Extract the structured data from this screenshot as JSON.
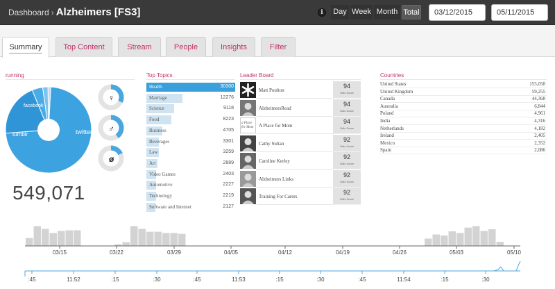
{
  "header": {
    "breadcrumb_home": "Dashboard",
    "breadcrumb_sep": "›",
    "breadcrumb_current": "Alzheimers [FS3]",
    "info_glyph": "i",
    "periods": [
      "Day",
      "Week",
      "Month",
      "Total"
    ],
    "active_period": "Total",
    "start_date": "03/12/2015",
    "end_date": "05/11/2015"
  },
  "tabs": [
    "Summary",
    "Top Content",
    "Stream",
    "People",
    "Insights",
    "Filter"
  ],
  "active_tab": "Summary",
  "source": {
    "title": "running",
    "total": "549,071",
    "donut_labels": [
      "twitter",
      "tumblr",
      "facebook"
    ],
    "donut_values": [
      73,
      20,
      4,
      2,
      1
    ],
    "colors": [
      "#3da3e0",
      "#2f95d6",
      "#4aace6",
      "#7cc3ee",
      "#b5dcf5"
    ],
    "gender": [
      {
        "icon": "female-icon",
        "glyph": "♀",
        "share": 0.32
      },
      {
        "icon": "male-icon",
        "glyph": "♂",
        "share": 0.4
      },
      {
        "icon": "unknown-gender-icon",
        "glyph": "ø",
        "share": 0.18
      }
    ]
  },
  "top_topics": {
    "title": "Top Topics",
    "items": [
      {
        "label": "Health",
        "value": "30300",
        "n": 30300
      },
      {
        "label": "Marriage",
        "value": "12276",
        "n": 12276
      },
      {
        "label": "Science",
        "value": "9118",
        "n": 9118
      },
      {
        "label": "Food",
        "value": "8223",
        "n": 8223
      },
      {
        "label": "Business",
        "value": "4705",
        "n": 4705
      },
      {
        "label": "Beverages",
        "value": "3301",
        "n": 3301
      },
      {
        "label": "Law",
        "value": "3259",
        "n": 3259
      },
      {
        "label": "Art",
        "value": "2889",
        "n": 2889
      },
      {
        "label": "Video Games",
        "value": "2403",
        "n": 2403
      },
      {
        "label": "Automotive",
        "value": "2227",
        "n": 2227
      },
      {
        "label": "Technology",
        "value": "2219",
        "n": 2219
      },
      {
        "label": "Software and Internet",
        "value": "2127",
        "n": 2127
      }
    ]
  },
  "leader_board": {
    "title": "Leader Board",
    "score_label": "Odio Score",
    "items": [
      {
        "name": "Matt Poulton",
        "score": "94"
      },
      {
        "name": "AlzheimersRead",
        "score": "94"
      },
      {
        "name": "A Place for Mom",
        "score": "94"
      },
      {
        "name": "Cathy Sultan",
        "score": "92"
      },
      {
        "name": "Caroline Kerley",
        "score": "92"
      },
      {
        "name": "Alzheimers Links",
        "score": "92"
      },
      {
        "name": "Training For Carers",
        "score": "92"
      }
    ],
    "logo_text": "a Place for Mom"
  },
  "countries": {
    "title": "Countries",
    "items": [
      {
        "name": "United States",
        "value": "155,058"
      },
      {
        "name": "United Kingdom",
        "value": "59,255"
      },
      {
        "name": "Canada",
        "value": "44,368"
      },
      {
        "name": "Australia",
        "value": "6,844"
      },
      {
        "name": "Poland",
        "value": "4,961"
      },
      {
        "name": "India",
        "value": "4,316"
      },
      {
        "name": "Netherlands",
        "value": "4,182"
      },
      {
        "name": "Ireland",
        "value": "2,405"
      },
      {
        "name": "Mexico",
        "value": "2,352"
      },
      {
        "name": "Spain",
        "value": "2,086"
      }
    ]
  },
  "timeline": {
    "date_ticks": [
      "03/15",
      "03/22",
      "03/29",
      "04/05",
      "04/12",
      "04/19",
      "04/26",
      "05/03",
      "05/10"
    ],
    "bars_left": [
      0.38,
      0.95,
      0.82,
      0.62,
      0.72,
      0.75,
      0.75
    ],
    "bars_mid": [
      0.08,
      0.18,
      0.95,
      0.82,
      0.68,
      0.68,
      0.62,
      0.62,
      0.58
    ],
    "bars_right": [
      0.35,
      0.55,
      0.5,
      0.7,
      0.62,
      0.88,
      0.95,
      0.72,
      0.8,
      0.2
    ],
    "time_ticks": [
      ":45",
      "11:52",
      ":15",
      ":30",
      ":45",
      "11:53",
      ":15",
      ":30",
      ":45",
      "11:54",
      ":15",
      ":30"
    ]
  }
}
